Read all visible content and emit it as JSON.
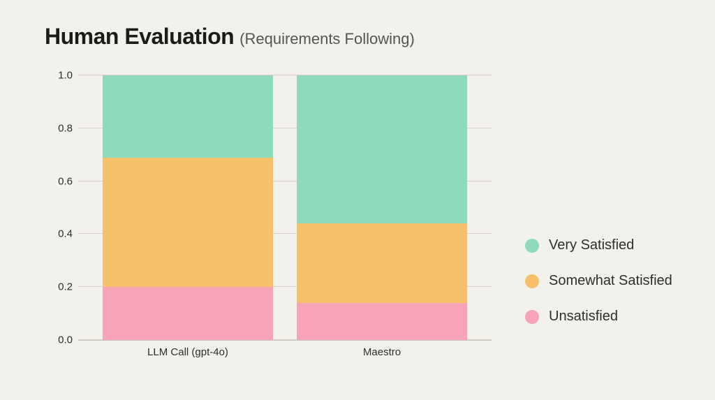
{
  "title": {
    "main": "Human Evaluation",
    "sub": "(Requirements Following)"
  },
  "legend": {
    "very": "Very Satisfied",
    "somewhat": "Somewhat Satisfied",
    "unsatisfied": "Unsatisfied"
  },
  "yaxis": {
    "ticks": [
      "0.0",
      "0.2",
      "0.4",
      "0.6",
      "0.8",
      "1.0"
    ]
  },
  "xaxis": {
    "labels": [
      "LLM Call (gpt-4o)",
      "Maestro"
    ]
  },
  "colors": {
    "very": "#8edabb",
    "somewhat": "#f7c06a",
    "unsatisfied": "#f6a4b6",
    "grid": "#d6d2c9",
    "axis": "#c8c4bb",
    "bg": "#f3f1ec"
  },
  "chart_data": {
    "type": "bar",
    "stacked": true,
    "normalized_to": 1.0,
    "title": "Human Evaluation (Requirements Following)",
    "xlabel": "",
    "ylabel": "",
    "ylim": [
      0.0,
      1.0
    ],
    "yticks": [
      0.0,
      0.2,
      0.4,
      0.6,
      0.8,
      1.0
    ],
    "categories": [
      "LLM Call (gpt-4o)",
      "Maestro"
    ],
    "series": [
      {
        "name": "Unsatisfied",
        "values": [
          0.2,
          0.14
        ]
      },
      {
        "name": "Somewhat Satisfied",
        "values": [
          0.49,
          0.3
        ]
      },
      {
        "name": "Very Satisfied",
        "values": [
          0.31,
          0.56
        ]
      }
    ],
    "legend_position": "right"
  }
}
